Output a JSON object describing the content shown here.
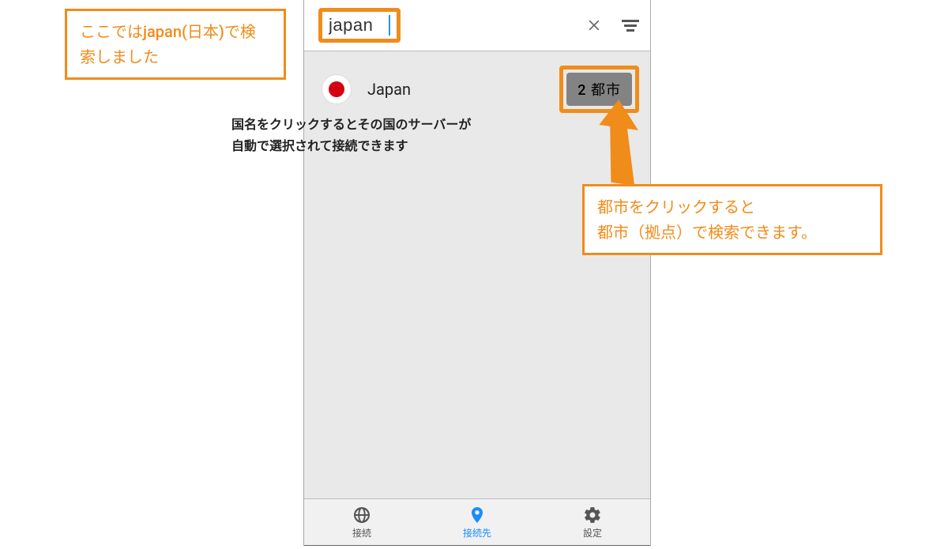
{
  "callouts": {
    "search_hint": "ここではjapan(日本)で検索しました",
    "city_hint_l1": "都市をクリックすると",
    "city_hint_l2": "都市（拠点）で検索できます。"
  },
  "search": {
    "value": "japan"
  },
  "results": {
    "country_name": "Japan",
    "city_button_label": "2 都市"
  },
  "instruction": {
    "line1": "国名をクリックするとその国のサーバーが",
    "line2": "自動で選択されて接続できます"
  },
  "nav": {
    "connect": "接続",
    "destinations": "接続先",
    "settings": "設定"
  },
  "colors": {
    "accent_orange": "#f08c1a",
    "accent_blue": "#1a8cff",
    "flag_red": "#d40012"
  }
}
